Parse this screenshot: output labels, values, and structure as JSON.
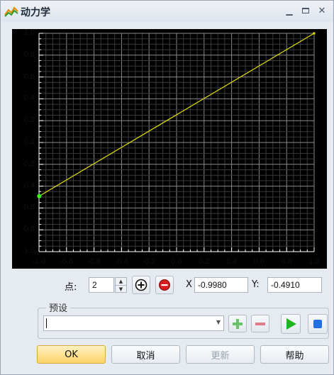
{
  "window": {
    "title": "动力学"
  },
  "chart_data": {
    "type": "line",
    "title": "",
    "xlabel": "",
    "ylabel": "",
    "xlim": [
      -1.0,
      1.0
    ],
    "ylim": [
      -1.0,
      1.0
    ],
    "grid": true,
    "xticks": [
      "-1.0",
      "-0.8",
      "-0.6",
      "-0.4",
      "-0.2",
      "0.0",
      "0.2",
      "0.4",
      "0.6",
      "0.8",
      "1.0"
    ],
    "yticks": [
      "1.0",
      "0.8",
      "0.6",
      "0.4",
      "0.2",
      "0.0",
      "-0.2",
      "-0.4",
      "-0.6",
      "-0.8",
      "-1.0"
    ],
    "series": [
      {
        "x": [
          -0.998,
          1.0
        ],
        "y": [
          -0.491,
          1.0
        ],
        "color": "#e0e000"
      }
    ],
    "selected_point": {
      "x": -0.998,
      "y": -0.491,
      "color": "#39ff14"
    }
  },
  "points": {
    "label": "点:",
    "value": "2"
  },
  "coords": {
    "x_label": "X",
    "x_value": "-0.9980",
    "y_label": "Y:",
    "y_value": "-0.4910"
  },
  "preset": {
    "title": "预设",
    "value": ""
  },
  "buttons": {
    "ok": "OK",
    "cancel": "取消",
    "update": "更新",
    "help": "帮助"
  },
  "icons": {
    "app": "chart-icon",
    "minimize": "minimize-icon",
    "maximize": "maximize-icon",
    "close": "close-icon",
    "add_point": "add-point-icon",
    "remove_point": "remove-point-icon",
    "add_preset": "plus-icon",
    "remove_preset": "minus-icon",
    "play": "play-icon",
    "stop": "stop-icon"
  }
}
